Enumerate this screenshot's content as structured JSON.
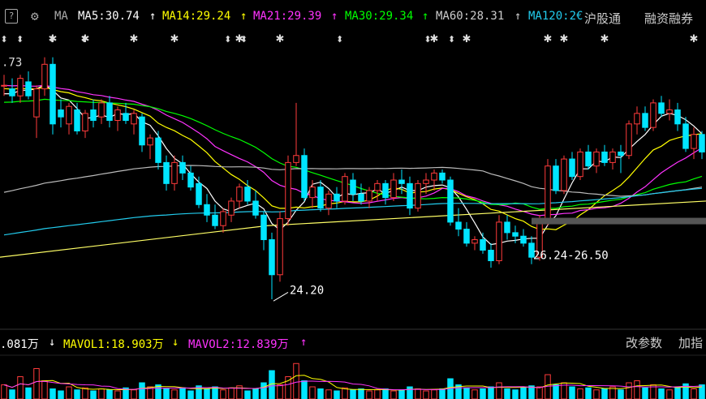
{
  "toolbar": {
    "help_label": "?",
    "indicator": "MA",
    "ma5": "MA5:30.74",
    "ma14": "MA14:29.24",
    "ma21": "MA21:29.39",
    "ma30": "MA30:29.34",
    "ma60": "MA60:28.31",
    "ma120": "MA120:2€",
    "arrow_up": "↑",
    "hgt_label": "沪股通",
    "margin_label": "融资融券"
  },
  "colors": {
    "up": "#ff3b3b",
    "down": "#00e5ff",
    "ma5": "#ffffff",
    "ma14": "#ffff00",
    "ma21": "#ff33ff",
    "ma30": "#00ff00",
    "ma60": "#bbbbbb",
    "ma120": "#22ccee",
    "long": "#ffff66"
  },
  "volume_bar": {
    "vol": ".081万",
    "vol_arrow": "↓",
    "mavol1": "MAVOL1:18.903万",
    "mavol1_arrow": "↓",
    "mavol2": "MAVOL2:12.839万",
    "mavol2_arrow": "↑",
    "edit_params": "改参数",
    "add_indicator": "加指"
  },
  "chart_data": {
    "type": "candlestick",
    "price_labels": {
      "high_left": ".73",
      "low_marker": "24.20",
      "range_marker": "26.24-26.50"
    },
    "y_range": [
      23.6,
      31.3
    ],
    "candles": [
      [
        30.3,
        30.6,
        30.0,
        30.3
      ],
      [
        30.2,
        30.5,
        29.8,
        30.0
      ],
      [
        30.0,
        30.6,
        29.8,
        30.5
      ],
      [
        30.4,
        30.7,
        29.9,
        30.0
      ],
      [
        29.4,
        30.3,
        28.8,
        30.2
      ],
      [
        30.2,
        31.1,
        30.0,
        30.9
      ],
      [
        30.9,
        31.1,
        28.9,
        29.2
      ],
      [
        29.6,
        29.9,
        29.1,
        29.4
      ],
      [
        29.2,
        29.8,
        28.9,
        29.7
      ],
      [
        29.6,
        29.8,
        28.9,
        29.0
      ],
      [
        29.0,
        29.6,
        28.8,
        29.5
      ],
      [
        29.6,
        29.9,
        29.1,
        29.3
      ],
      [
        29.4,
        29.9,
        29.2,
        29.8
      ],
      [
        29.8,
        30.0,
        29.1,
        29.3
      ],
      [
        29.3,
        29.7,
        29.0,
        29.6
      ],
      [
        29.5,
        29.8,
        29.2,
        29.3
      ],
      [
        29.2,
        29.6,
        28.9,
        29.5
      ],
      [
        29.4,
        29.5,
        28.4,
        28.6
      ],
      [
        28.6,
        28.9,
        28.2,
        28.8
      ],
      [
        28.8,
        29.0,
        27.9,
        28.1
      ],
      [
        28.1,
        28.3,
        27.3,
        27.5
      ],
      [
        27.5,
        28.3,
        27.3,
        28.1
      ],
      [
        28.1,
        28.3,
        27.6,
        27.8
      ],
      [
        27.8,
        28.0,
        27.3,
        27.4
      ],
      [
        27.5,
        27.7,
        26.8,
        26.9
      ],
      [
        26.9,
        27.2,
        26.4,
        26.6
      ],
      [
        26.6,
        26.9,
        26.2,
        26.3
      ],
      [
        26.3,
        26.8,
        26.1,
        26.7
      ],
      [
        26.6,
        27.1,
        26.4,
        27.0
      ],
      [
        27.0,
        27.5,
        26.8,
        27.4
      ],
      [
        27.4,
        27.6,
        26.9,
        27.0
      ],
      [
        27.0,
        27.3,
        26.5,
        26.6
      ],
      [
        26.6,
        26.7,
        25.6,
        25.9
      ],
      [
        25.9,
        26.1,
        24.2,
        24.9
      ],
      [
        24.9,
        26.7,
        24.7,
        26.5
      ],
      [
        26.5,
        28.3,
        26.3,
        28.1
      ],
      [
        28.1,
        29.8,
        28.0,
        28.3
      ],
      [
        28.3,
        28.5,
        27.0,
        27.1
      ],
      [
        27.1,
        27.6,
        26.8,
        27.4
      ],
      [
        27.4,
        27.6,
        26.7,
        26.8
      ],
      [
        26.8,
        27.3,
        26.6,
        27.2
      ],
      [
        27.2,
        27.4,
        26.8,
        27.0
      ],
      [
        27.0,
        27.8,
        26.9,
        27.7
      ],
      [
        27.6,
        27.8,
        27.0,
        27.2
      ],
      [
        27.2,
        27.5,
        26.9,
        27.0
      ],
      [
        27.0,
        27.4,
        26.8,
        27.3
      ],
      [
        27.3,
        27.6,
        27.0,
        27.5
      ],
      [
        27.5,
        27.6,
        26.9,
        27.1
      ],
      [
        27.1,
        27.8,
        27.0,
        27.6
      ],
      [
        27.6,
        27.9,
        27.2,
        27.5
      ],
      [
        27.5,
        27.7,
        26.6,
        26.8
      ],
      [
        26.8,
        27.6,
        26.7,
        27.5
      ],
      [
        27.5,
        27.8,
        27.2,
        27.6
      ],
      [
        27.6,
        27.9,
        27.3,
        27.8
      ],
      [
        27.8,
        27.9,
        27.5,
        27.6
      ],
      [
        27.6,
        27.7,
        26.3,
        26.4
      ],
      [
        26.4,
        26.8,
        26.0,
        26.2
      ],
      [
        26.2,
        26.4,
        25.7,
        25.8
      ],
      [
        25.8,
        26.0,
        25.6,
        25.9
      ],
      [
        25.9,
        26.1,
        25.5,
        25.6
      ],
      [
        25.6,
        25.8,
        25.1,
        25.3
      ],
      [
        25.3,
        26.6,
        25.2,
        26.4
      ],
      [
        26.4,
        26.6,
        25.9,
        26.1
      ],
      [
        26.1,
        26.3,
        25.8,
        26.0
      ],
      [
        26.0,
        26.2,
        25.7,
        25.8
      ],
      [
        25.8,
        26.0,
        25.2,
        25.4
      ],
      [
        25.4,
        26.6,
        25.3,
        26.4
      ],
      [
        26.4,
        28.2,
        26.3,
        28.0
      ],
      [
        28.0,
        28.2,
        27.2,
        27.3
      ],
      [
        27.3,
        28.3,
        27.2,
        28.2
      ],
      [
        28.2,
        28.4,
        27.6,
        27.7
      ],
      [
        27.7,
        28.5,
        27.6,
        28.4
      ],
      [
        28.4,
        28.6,
        27.9,
        28.0
      ],
      [
        28.0,
        28.5,
        27.8,
        28.4
      ],
      [
        28.4,
        28.6,
        28.0,
        28.1
      ],
      [
        28.1,
        28.5,
        27.9,
        28.4
      ],
      [
        28.4,
        28.6,
        27.8,
        28.3
      ],
      [
        28.3,
        29.3,
        28.2,
        29.2
      ],
      [
        29.2,
        29.7,
        28.9,
        29.5
      ],
      [
        29.5,
        29.7,
        29.0,
        29.1
      ],
      [
        29.1,
        29.9,
        29.0,
        29.8
      ],
      [
        29.8,
        30.0,
        29.4,
        29.5
      ],
      [
        29.5,
        29.9,
        29.3,
        29.6
      ],
      [
        29.6,
        29.8,
        29.0,
        29.2
      ],
      [
        29.2,
        29.4,
        28.4,
        28.5
      ],
      [
        28.5,
        29.1,
        28.2,
        28.9
      ],
      [
        28.9,
        29.0,
        28.2,
        28.4
      ]
    ],
    "volume": [
      14,
      9,
      22,
      11,
      30,
      18,
      10,
      8,
      12,
      9,
      11,
      8,
      10,
      9,
      8,
      11,
      9,
      16,
      12,
      14,
      10,
      9,
      11,
      8,
      13,
      10,
      12,
      9,
      11,
      13,
      8,
      10,
      16,
      28,
      14,
      22,
      35,
      18,
      12,
      10,
      9,
      8,
      11,
      9,
      10,
      8,
      9,
      10,
      8,
      9,
      12,
      10,
      8,
      9,
      10,
      20,
      14,
      11,
      9,
      10,
      12,
      16,
      10,
      9,
      11,
      13,
      12,
      24,
      14,
      16,
      12,
      10,
      11,
      9,
      10,
      12,
      9,
      16,
      18,
      11,
      14,
      10,
      9,
      12,
      15,
      10,
      14
    ]
  }
}
